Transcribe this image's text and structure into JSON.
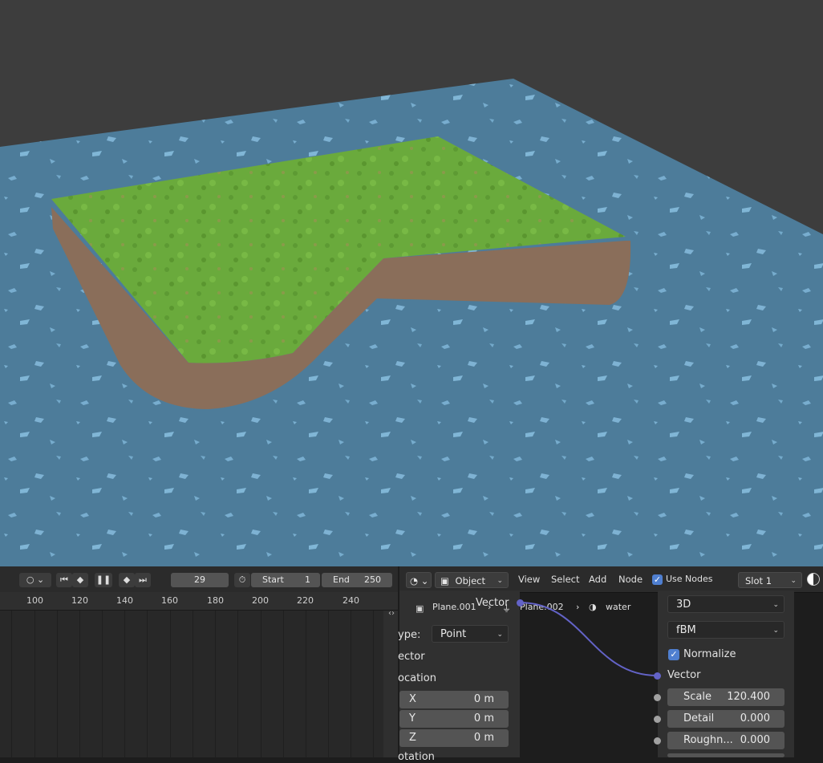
{
  "timeline": {
    "current_frame": "29",
    "start_label": "Start",
    "start_value": "1",
    "end_label": "End",
    "end_value": "250",
    "ruler_ticks": [
      "100",
      "120",
      "140",
      "160",
      "180",
      "200",
      "220",
      "240"
    ]
  },
  "node_editor": {
    "header": {
      "mode": "Object",
      "menus": [
        "View",
        "Select",
        "Add",
        "Node"
      ],
      "use_nodes_label": "Use Nodes",
      "use_nodes_checked": true,
      "slot": "Slot 1"
    },
    "breadcrumb": {
      "object": "Plane.001",
      "mesh": "Plane.002",
      "material": "water"
    },
    "left_node": {
      "output_label": "Vector",
      "type_label": "ype:",
      "type_value": "Point",
      "vector_label": "ector",
      "location_label": "ocation",
      "x_label": "X",
      "x_value": "0 m",
      "y_label": "Y",
      "y_value": "0 m",
      "z_label": "Z",
      "z_value": "0 m",
      "rotation_label": "otation"
    },
    "right_node": {
      "dimensions": "3D",
      "noise_type": "fBM",
      "normalize_label": "Normalize",
      "vector_label": "Vector",
      "scale_label": "Scale",
      "scale_value": "120.400",
      "detail_label": "Detail",
      "detail_value": "0.000",
      "roughness_label": "Roughn...",
      "roughness_value": "0.000"
    },
    "colors": {
      "vector_socket": "#6363c7",
      "float_socket": "#a1a1a1",
      "checkbox": "#4f7fd0"
    }
  }
}
